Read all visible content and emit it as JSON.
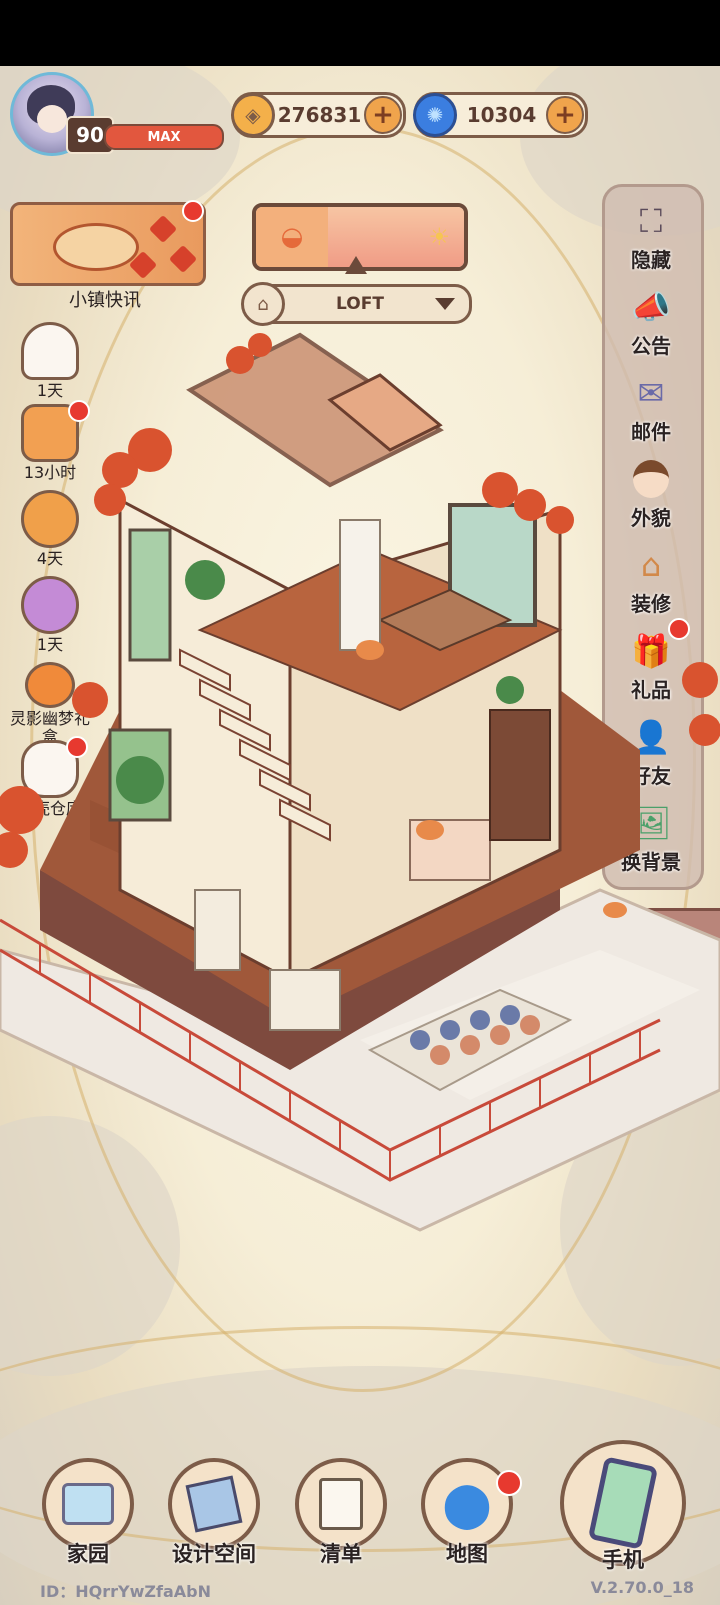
{
  "player": {
    "level": "90",
    "level_status": "MAX"
  },
  "currency": {
    "coins": {
      "icon": "coin-icon",
      "value": "276831"
    },
    "gems": {
      "icon": "swirl-gem-icon",
      "value": "10304"
    }
  },
  "news": {
    "label": "小镇快讯"
  },
  "room": {
    "name": "LOFT"
  },
  "left_events": [
    {
      "icon": "ghost-icon",
      "label": "1天"
    },
    {
      "icon": "delivery-truck-icon",
      "label": "13小时"
    },
    {
      "icon": "pumpkin-witch-icon",
      "label": "4天"
    },
    {
      "icon": "pumpkin-gift-icon",
      "label": "1天"
    },
    {
      "icon": "jack-o-lantern-icon",
      "label": "灵影幽梦礼盒"
    },
    {
      "icon": "cat-storage-icon",
      "label": "蜗壳仓库"
    }
  ],
  "right_menu": [
    {
      "icon": "hide-frame-icon",
      "label": "隐藏"
    },
    {
      "icon": "announcement-icon",
      "label": "公告"
    },
    {
      "icon": "mail-icon",
      "label": "邮件"
    },
    {
      "icon": "character-icon",
      "label": "外貌"
    },
    {
      "icon": "renovate-icon",
      "label": "装修"
    },
    {
      "icon": "gift-icon",
      "label": "礼品"
    },
    {
      "icon": "friends-icon",
      "label": "好友"
    },
    {
      "icon": "change-background-icon",
      "label": "换背景"
    }
  ],
  "bottom_nav": [
    {
      "icon": "home-garden-icon",
      "label": "家园"
    },
    {
      "icon": "design-space-icon",
      "label": "设计空间"
    },
    {
      "icon": "checklist-icon",
      "label": "清单"
    },
    {
      "icon": "map-pin-icon",
      "label": "地图"
    },
    {
      "icon": "phone-icon",
      "label": "手机"
    }
  ],
  "footer": {
    "id": "ID：HQrrYwZfaAbN",
    "version": "V.2.70.0_18"
  },
  "colors": {
    "accent": "#e7392f",
    "frame": "#7d5c48",
    "wood": "#a0583a"
  }
}
